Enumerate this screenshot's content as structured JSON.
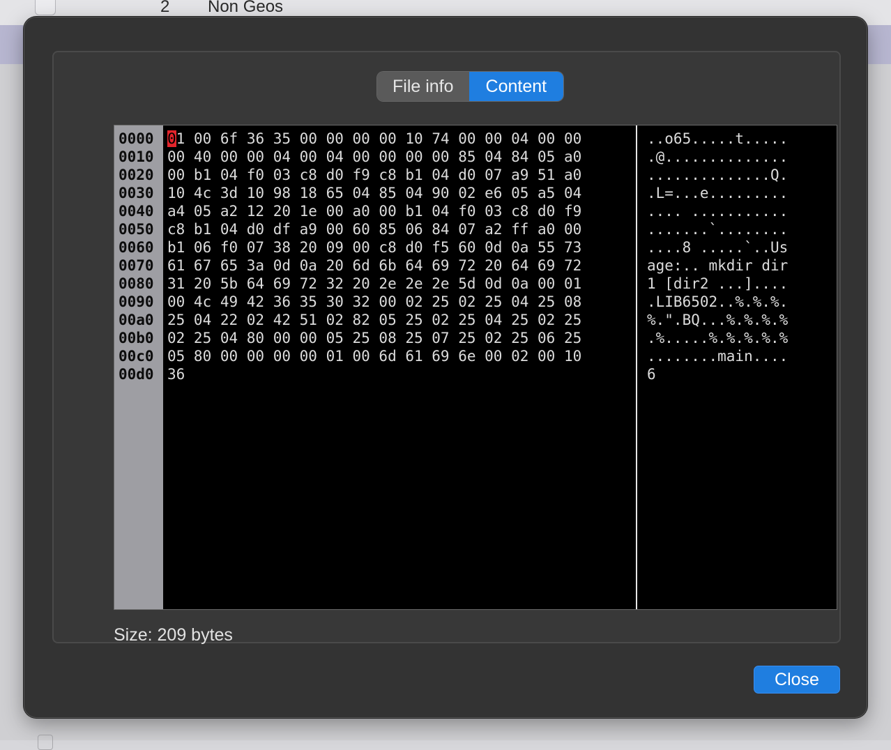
{
  "background": {
    "row_number": "2",
    "row_name": "Non Geos"
  },
  "tabs": [
    {
      "label": "File info",
      "active": false
    },
    {
      "label": "Content",
      "active": true
    }
  ],
  "hex": {
    "offsets": [
      "0000",
      "0010",
      "0020",
      "0030",
      "0040",
      "0050",
      "0060",
      "0070",
      "0080",
      "0090",
      "00a0",
      "00b0",
      "00c0",
      "00d0"
    ],
    "first_byte": "01",
    "rows": [
      " 00 6f 36 35 00 00 00 00 10 74 00 00 04 00 00",
      "00 40 00 00 04 00 04 00 00 00 00 85 04 84 05 a0",
      "00 b1 04 f0 03 c8 d0 f9 c8 b1 04 d0 07 a9 51 a0",
      "10 4c 3d 10 98 18 65 04 85 04 90 02 e6 05 a5 04",
      "a4 05 a2 12 20 1e 00 a0 00 b1 04 f0 03 c8 d0 f9",
      "c8 b1 04 d0 df a9 00 60 85 06 84 07 a2 ff a0 00",
      "b1 06 f0 07 38 20 09 00 c8 d0 f5 60 0d 0a 55 73",
      "61 67 65 3a 0d 0a 20 6d 6b 64 69 72 20 64 69 72",
      "31 20 5b 64 69 72 32 20 2e 2e 2e 5d 0d 0a 00 01",
      "00 4c 49 42 36 35 30 32 00 02 25 02 25 04 25 08",
      "25 04 22 02 42 51 02 82 05 25 02 25 04 25 02 25",
      "02 25 04 80 00 00 05 25 08 25 07 25 02 25 06 25",
      "05 80 00 00 00 00 01 00 6d 61 69 6e 00 02 00 10",
      "36"
    ],
    "ascii": [
      "..o65.....t.....",
      ".@..............",
      "..............Q.",
      ".L=...e.........",
      ".... ...........",
      ".......`........",
      "....8 .....`..Us",
      "age:.. mkdir dir",
      "1 [dir2 ...]....",
      ".LIB6502..%.%.%.",
      "%.\".BQ...%.%.%.%",
      ".%.....%.%.%.%.%",
      "........main....",
      "6"
    ]
  },
  "size_text": "Size: 209 bytes",
  "close_label": "Close"
}
